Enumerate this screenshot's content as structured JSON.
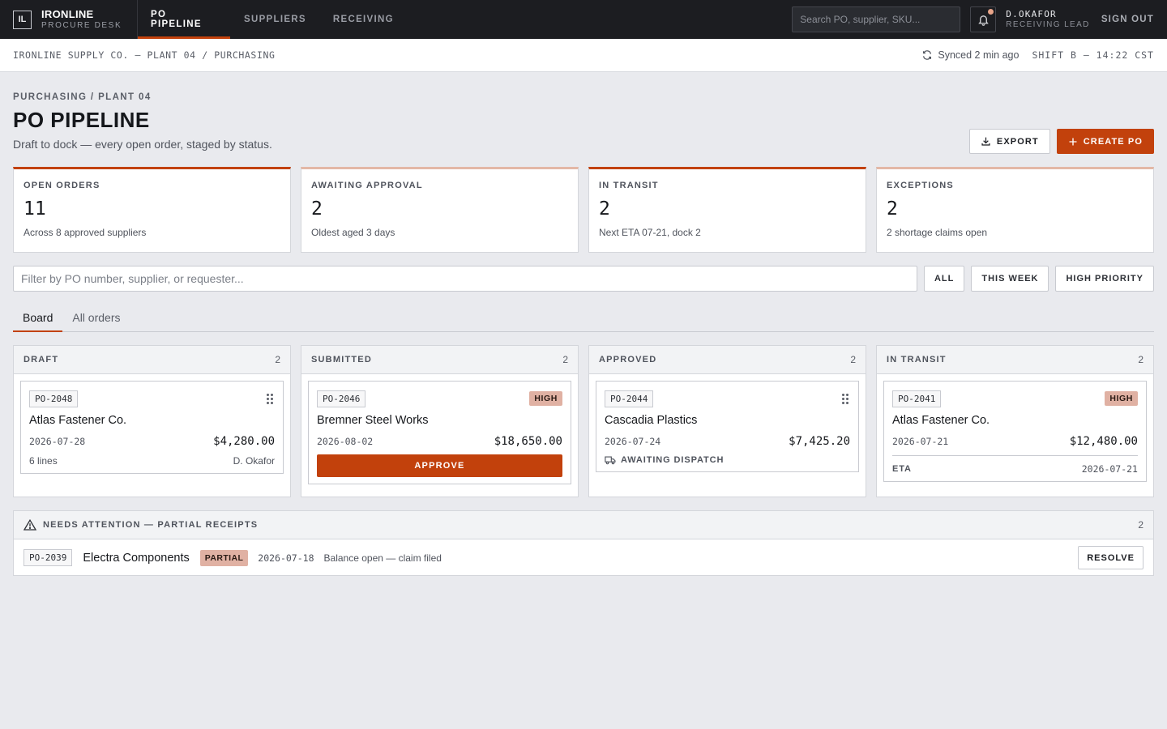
{
  "topbar": {
    "logo_mark": "IL",
    "brand_name": "IRONLINE",
    "brand_sub": "PROCURE DESK",
    "nav": [
      {
        "label": "PO PIPELINE",
        "active": true
      },
      {
        "label": "SUPPLIERS",
        "active": false
      },
      {
        "label": "RECEIVING",
        "active": false
      }
    ],
    "search_placeholder": "Search PO, supplier, SKU...",
    "user_name": "D.OKAFOR",
    "user_role": "RECEIVING LEAD",
    "signout_label": "SIGN OUT"
  },
  "context": {
    "path": "IRONLINE SUPPLY CO. — PLANT 04 / PURCHASING",
    "sync": "Synced 2 min ago",
    "shift": "SHIFT B — 14:22 CST"
  },
  "header": {
    "crumb": "PURCHASING / PLANT 04",
    "title": "PO PIPELINE",
    "subtitle": "Draft to dock — every open order, staged by status.",
    "export_label": "EXPORT",
    "create_label": "CREATE PO"
  },
  "stats": [
    {
      "label": "OPEN ORDERS",
      "value": "11",
      "note": "Across 8 approved suppliers"
    },
    {
      "label": "AWAITING APPROVAL",
      "value": "2",
      "note": "Oldest aged 3 days"
    },
    {
      "label": "IN TRANSIT",
      "value": "2",
      "note": "Next ETA 07-21, dock 2"
    },
    {
      "label": "EXCEPTIONS",
      "value": "2",
      "note": "2 shortage claims open"
    }
  ],
  "filter": {
    "placeholder": "Filter by PO number, supplier, or requester...",
    "chips": [
      "ALL",
      "THIS WEEK",
      "HIGH PRIORITY"
    ]
  },
  "tabs": [
    {
      "label": "Board",
      "active": true
    },
    {
      "label": "All orders",
      "active": false
    }
  ],
  "board": {
    "draft": {
      "title": "DRAFT",
      "count": "2",
      "card": {
        "po": "PO-2048",
        "supplier": "Atlas Fastener Co.",
        "date": "2026-07-28",
        "amount": "$4,280.00",
        "lines": "6 lines",
        "requester": "D. Okafor"
      }
    },
    "submitted": {
      "title": "SUBMITTED",
      "count": "2",
      "card": {
        "po": "PO-2046",
        "badge": "HIGH",
        "supplier": "Bremner Steel Works",
        "date": "2026-08-02",
        "amount": "$18,650.00",
        "action": "APPROVE"
      }
    },
    "approved": {
      "title": "APPROVED",
      "count": "2",
      "card": {
        "po": "PO-2044",
        "supplier": "Cascadia Plastics",
        "date": "2026-07-24",
        "amount": "$7,425.20",
        "status": "AWAITING DISPATCH"
      }
    },
    "transit": {
      "title": "IN TRANSIT",
      "count": "2",
      "card": {
        "po": "PO-2041",
        "badge": "HIGH",
        "supplier": "Atlas Fastener Co.",
        "date": "2026-07-21",
        "amount": "$12,480.00",
        "eta_label": "ETA",
        "eta_date": "2026-07-21"
      }
    }
  },
  "attention": {
    "title": "NEEDS ATTENTION — PARTIAL RECEIPTS",
    "count": "2",
    "row": {
      "po": "PO-2039",
      "supplier": "Electra Components",
      "badge": "PARTIAL",
      "date": "2026-07-18",
      "note": "Balance open — claim filed",
      "action": "RESOLVE"
    }
  },
  "colors": {
    "accent": "#c2410c",
    "badge": "#e0b1a3",
    "topbar": "#1c1d21",
    "background": "#e9eaee"
  }
}
